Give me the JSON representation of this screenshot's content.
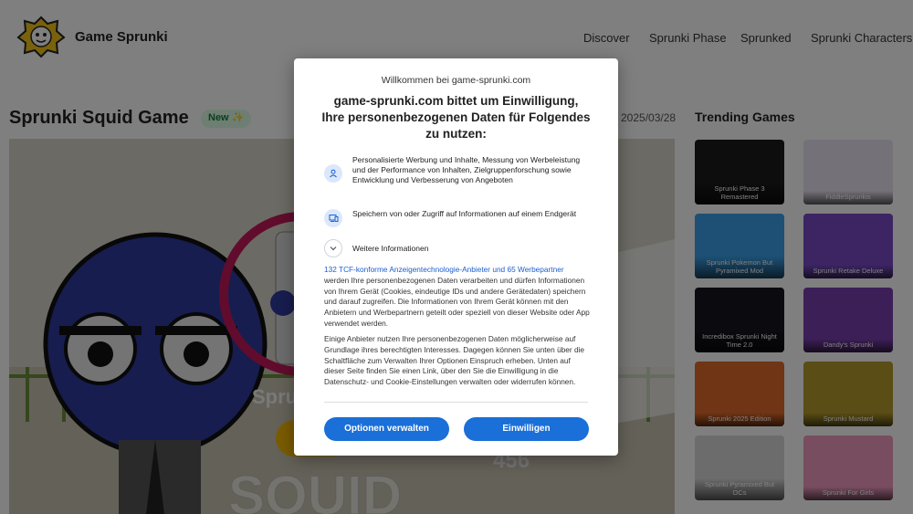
{
  "header": {
    "site_name": "Game Sprunki",
    "logo_text": "Game Sprunki",
    "nav": [
      "Discover",
      "Sprunki Phase",
      "Sprunked",
      "Sprunki Characters"
    ]
  },
  "game": {
    "title": "Sprunki Squid Game",
    "badge": "New ✨",
    "date": "2025/03/28",
    "overlay_text": "Spru",
    "background_text": "SQUID",
    "number_text": "456"
  },
  "trending": {
    "title": "Trending Games",
    "items": [
      {
        "label": "Sprunki Phase 3 Remastered",
        "color": "#1a1a1a"
      },
      {
        "label": "FiddleSprunkis",
        "color": "#e9e3f2"
      },
      {
        "label": "Sprunki Pokemon But Pyramixed Mod",
        "color": "#3aa0e8"
      },
      {
        "label": "Sprunki Retake Deluxe",
        "color": "#7a4bc9"
      },
      {
        "label": "Incredibox Sprunki Night Time 2.0",
        "color": "#15151f"
      },
      {
        "label": "Dandy's Sprunki",
        "color": "#7b3fb0"
      },
      {
        "label": "Sprunki 2025 Edition",
        "color": "#e06a2a"
      },
      {
        "label": "Sprunki Mustard",
        "color": "#b59b2b"
      },
      {
        "label": "Sprunki Pyramixed But OCs",
        "color": "#d9d9d9"
      },
      {
        "label": "Sprunki For Girls",
        "color": "#f29ac0"
      }
    ]
  },
  "consent": {
    "welcome": "Willkommen bei game-sprunki.com",
    "heading": "game-sprunki.com bittet um Einwilligung, Ihre personenbezogenen Daten für Folgendes zu nutzen:",
    "purposes": [
      {
        "icon": "person-icon",
        "text": "Personalisierte Werbung und Inhalte, Messung von Werbeleistung und der Performance von Inhalten, Zielgruppenforschung sowie Entwicklung und Verbesserung von Angeboten"
      },
      {
        "icon": "device-icon",
        "text": "Speichern von oder Zugriff auf Informationen auf einem Endgerät"
      }
    ],
    "more_info": "Weitere Informationen",
    "vendors_link": "132 TCF-konforme Anzeigentechnologie-Anbieter und 65 Werbepartner",
    "paragraph1_rest": " werden Ihre personenbezogenen Daten verarbeiten und dürfen Informationen von Ihrem Gerät (Cookies, eindeutige IDs und andere Gerätedaten) speichern und darauf zugreifen. Die Informationen von Ihrem Gerät können mit den Anbietern und Werbepartnern geteilt oder speziell von dieser Website oder App verwendet werden.",
    "paragraph2": "Einige Anbieter nutzen Ihre personenbezogenen Daten möglicherweise auf Grundlage ihres berechtigten Interesses. Dagegen können Sie unten über die Schaltfläche zum Verwalten Ihrer Optionen Einspruch erheben. Unten auf dieser Seite finden Sie einen Link, über den Sie die Einwilligung in die Datenschutz- und Cookie-Einstellungen verwalten oder widerrufen können.",
    "manage_button": "Optionen verwalten",
    "accept_button": "Einwilligen"
  },
  "colors": {
    "accent": "#1a6fd8",
    "link": "#1a5fd1",
    "badge_bg": "#dcfce7"
  }
}
